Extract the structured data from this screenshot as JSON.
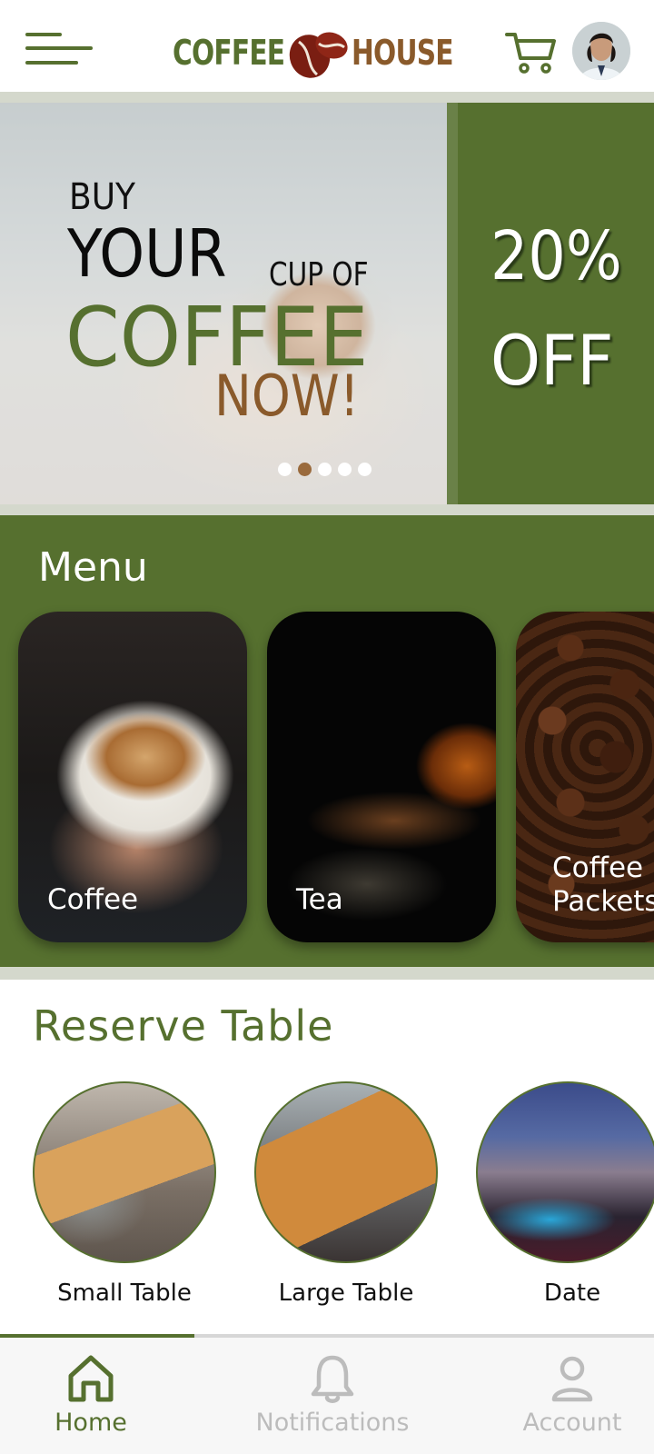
{
  "colors": {
    "brand_green": "#56702f",
    "brand_brown": "#8a5a2b",
    "inactive": "#bcbcbc"
  },
  "header": {
    "logo_word_1": "COFFEE",
    "logo_word_2": "HOUSE",
    "menu_icon": "hamburger-icon",
    "cart_icon": "cart-icon",
    "avatar_icon": "profile-avatar"
  },
  "banner": {
    "line1": "BUY",
    "line2": "YOUR",
    "line3": "CUP OF",
    "line4": "COFFEE",
    "line5": "NOW!",
    "discount": "20%",
    "discount_label": "OFF",
    "slides_count": 5,
    "active_slide": 2
  },
  "menu": {
    "title": "Menu",
    "items": [
      {
        "label": "Coffee"
      },
      {
        "label": "Tea"
      },
      {
        "label": "Coffee Packets"
      }
    ]
  },
  "reserve": {
    "title": "Reserve Table",
    "items": [
      {
        "label": "Small Table"
      },
      {
        "label": "Large Table"
      },
      {
        "label": "Date"
      }
    ]
  },
  "bottom_nav": {
    "active": "Home",
    "items": [
      {
        "label": "Home",
        "icon": "home-icon"
      },
      {
        "label": "Notifications",
        "icon": "bell-icon"
      },
      {
        "label": "Account",
        "icon": "user-icon"
      }
    ]
  }
}
